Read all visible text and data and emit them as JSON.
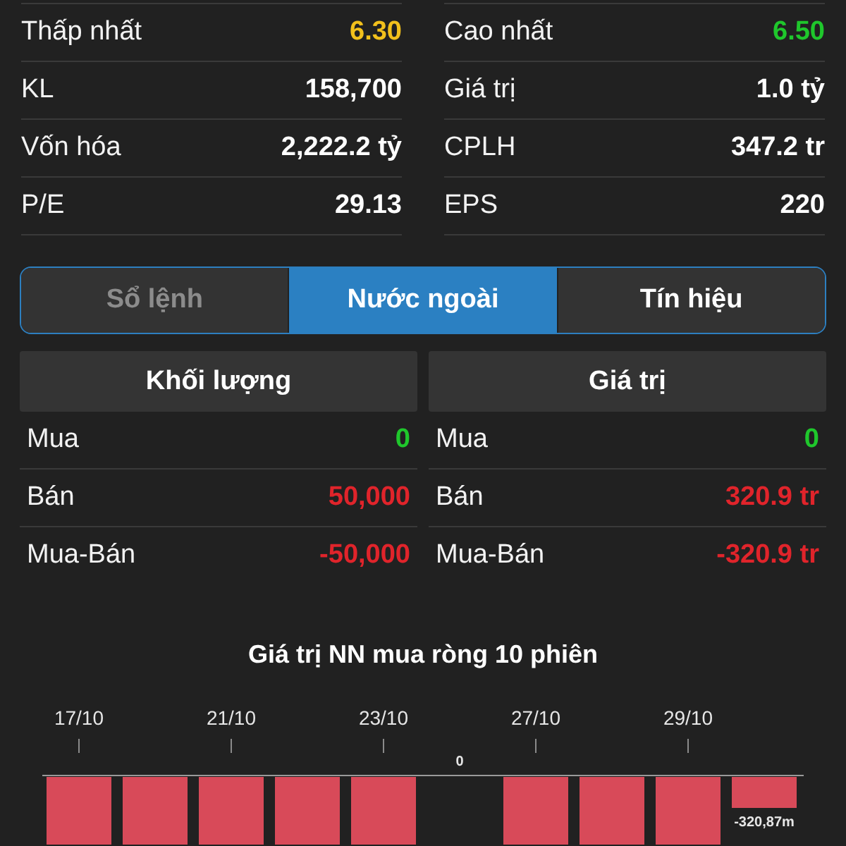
{
  "stats": [
    {
      "left": {
        "label": "Thấp nhất",
        "value": "6.30",
        "color": "#f2c01c"
      },
      "right": {
        "label": "Cao nhất",
        "value": "6.50",
        "color": "#1fc72c"
      }
    },
    {
      "left": {
        "label": "KL",
        "value": "158,700"
      },
      "right": {
        "label": "Giá trị",
        "value": "1.0 tỷ"
      }
    },
    {
      "left": {
        "label": "Vốn hóa",
        "value": "2,222.2 tỷ"
      },
      "right": {
        "label": "CPLH",
        "value": "347.2 tr"
      }
    },
    {
      "left": {
        "label": "P/E",
        "value": "29.13"
      },
      "right": {
        "label": "EPS",
        "value": "220"
      }
    }
  ],
  "tabs": [
    {
      "label": "Sổ lệnh",
      "selected": false
    },
    {
      "label": "Nước ngoài",
      "selected": true
    },
    {
      "label": "Tín hiệu",
      "selected": false
    }
  ],
  "foreign_tables": [
    {
      "header": "Khối lượng",
      "rows": [
        {
          "label": "Mua",
          "value": "0",
          "color": "#1fc72c"
        },
        {
          "label": "Bán",
          "value": "50,000",
          "color": "#e0242b"
        },
        {
          "label": "Mua-Bán",
          "value": "-50,000",
          "color": "#e0242b"
        }
      ]
    },
    {
      "header": "Giá trị",
      "rows": [
        {
          "label": "Mua",
          "value": "0",
          "color": "#1fc72c"
        },
        {
          "label": "Bán",
          "value": "320.9 tr",
          "color": "#e0242b"
        },
        {
          "label": "Mua-Bán",
          "value": "-320.9 tr",
          "color": "#e0242b"
        }
      ]
    }
  ],
  "chart": {
    "title": "Giá trị NN mua ròng 10 phiên",
    "bars": [
      {
        "kind": "negative",
        "date": "17/10"
      },
      {
        "kind": "negative"
      },
      {
        "kind": "negative",
        "date": "21/10"
      },
      {
        "kind": "negative"
      },
      {
        "kind": "negative",
        "date": "23/10"
      },
      {
        "kind": "zero",
        "label": "0"
      },
      {
        "kind": "negative",
        "date": "27/10"
      },
      {
        "kind": "negative"
      },
      {
        "kind": "negative",
        "date": "29/10"
      },
      {
        "kind": "small_negative",
        "label": "-320,87m"
      }
    ]
  }
}
